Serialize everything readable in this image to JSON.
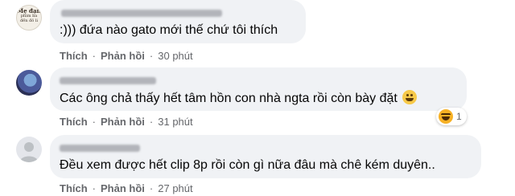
{
  "comments": [
    {
      "avatar_text_1": "Mẹ đạn",
      "avatar_text_2": "phim ba",
      "avatar_text_3": "đến đỏ li",
      "text": ":))) đứa nào gato mới thế chứ tôi thích",
      "like_label": "Thích",
      "reply_label": "Phản hồi",
      "time": "30 phút"
    },
    {
      "text": "Các ông chả thấy hết tâm hồn con nhà ngta rồi còn bày đặt",
      "emoji": "grinning-face-emoji",
      "like_label": "Thích",
      "reply_label": "Phản hồi",
      "time": "31 phút",
      "reaction_count": "1",
      "reaction_type": "haha"
    },
    {
      "text": "Đều xem được hết clip 8p rồi còn gì nữa đâu mà chê kém duyên..",
      "like_label": "Thích",
      "reply_label": "Phản hồi",
      "time": "27 phút"
    }
  ],
  "separator": "·",
  "colors": {
    "bubble": "#f0f2f5",
    "meta": "#65676b",
    "text": "#050505"
  }
}
